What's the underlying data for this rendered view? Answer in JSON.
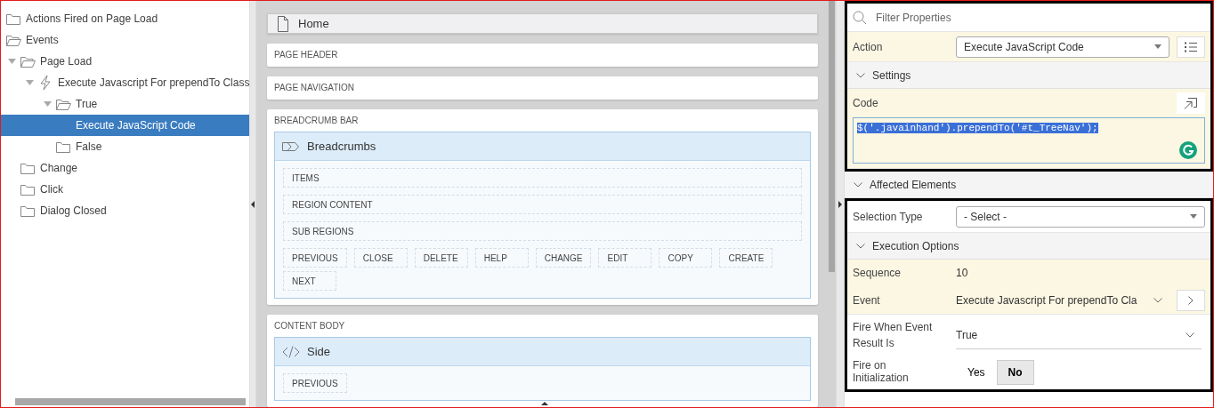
{
  "tree": [
    {
      "label": "Actions Fired on Page Load",
      "kind": "folder",
      "expanded": false,
      "selected": false
    },
    {
      "label": "Events",
      "kind": "folder",
      "expanded": true,
      "selected": false,
      "children": [
        {
          "label": "Page Load",
          "kind": "folder",
          "expanded": true,
          "selected": false,
          "children": [
            {
              "label": "Execute Javascript For prependTo Class",
              "kind": "event-action",
              "expanded": true,
              "selected": false,
              "children": [
                {
                  "label": "True",
                  "kind": "folder",
                  "expanded": true,
                  "selected": false,
                  "children": [
                    {
                      "label": "Execute JavaScript Code",
                      "expanded": false,
                      "selected": true
                    }
                  ]
                },
                {
                  "label": "False",
                  "kind": "folder",
                  "expanded": false,
                  "selected": false
                }
              ]
            }
          ]
        },
        {
          "label": "Change",
          "kind": "folder",
          "expanded": false,
          "selected": false
        },
        {
          "label": "Click",
          "kind": "folder",
          "expanded": false,
          "selected": false
        },
        {
          "label": "Dialog Closed",
          "kind": "folder",
          "expanded": false,
          "selected": false
        }
      ]
    }
  ],
  "layout": {
    "page_title": "Home",
    "sections": [
      {
        "title": "PAGE HEADER"
      },
      {
        "title": "PAGE NAVIGATION"
      },
      {
        "title": "BREADCRUMB BAR",
        "region": {
          "title": "Breadcrumbs",
          "kind": "breadcrumb",
          "slots": [
            "ITEMS",
            "REGION CONTENT",
            "SUB REGIONS"
          ],
          "buttons": [
            "PREVIOUS",
            "CLOSE",
            "DELETE",
            "HELP",
            "CHANGE",
            "EDIT",
            "COPY",
            "CREATE",
            "NEXT"
          ]
        }
      },
      {
        "title": "CONTENT BODY",
        "region": {
          "title": "Side",
          "kind": "code",
          "buttons": [
            "PREVIOUS"
          ]
        }
      }
    ]
  },
  "properties": {
    "filter": {
      "placeholder": "Filter Properties"
    },
    "blocks": [
      {
        "framed": true,
        "items": [
          {
            "kind": "select",
            "label": "Action",
            "value": "Execute JavaScript Code",
            "highlighted": true,
            "menu_button": true
          },
          {
            "kind": "section",
            "label": "Settings",
            "expanded": true
          },
          {
            "kind": "code",
            "label": "Code",
            "value": "$('.javainhand').prependTo('#t_TreeNav');",
            "highlighted": true,
            "text_selected": true
          }
        ]
      },
      {
        "framed": false,
        "items": [
          {
            "kind": "section",
            "label": "Affected Elements",
            "expanded": true
          }
        ]
      },
      {
        "framed": true,
        "items": [
          {
            "kind": "select",
            "label": "Selection Type",
            "value": "- Select -",
            "highlighted": false,
            "menu_button": false
          },
          {
            "kind": "section",
            "label": "Execution Options",
            "expanded": true
          },
          {
            "kind": "text",
            "label": "Sequence",
            "value": "10",
            "highlighted": true
          },
          {
            "kind": "link-select",
            "label": "Event",
            "value": "Execute Javascript For prependTo Cla",
            "highlighted": true
          },
          {
            "kind": "plain-select",
            "label": "Fire When Event Result Is",
            "value": "True",
            "highlighted": false
          },
          {
            "kind": "toggle",
            "label": "Fire on Initialization",
            "highlighted": false,
            "options": [
              {
                "label": "Yes",
                "selected": false
              },
              {
                "label": "No",
                "selected": true
              }
            ]
          }
        ]
      }
    ]
  }
}
